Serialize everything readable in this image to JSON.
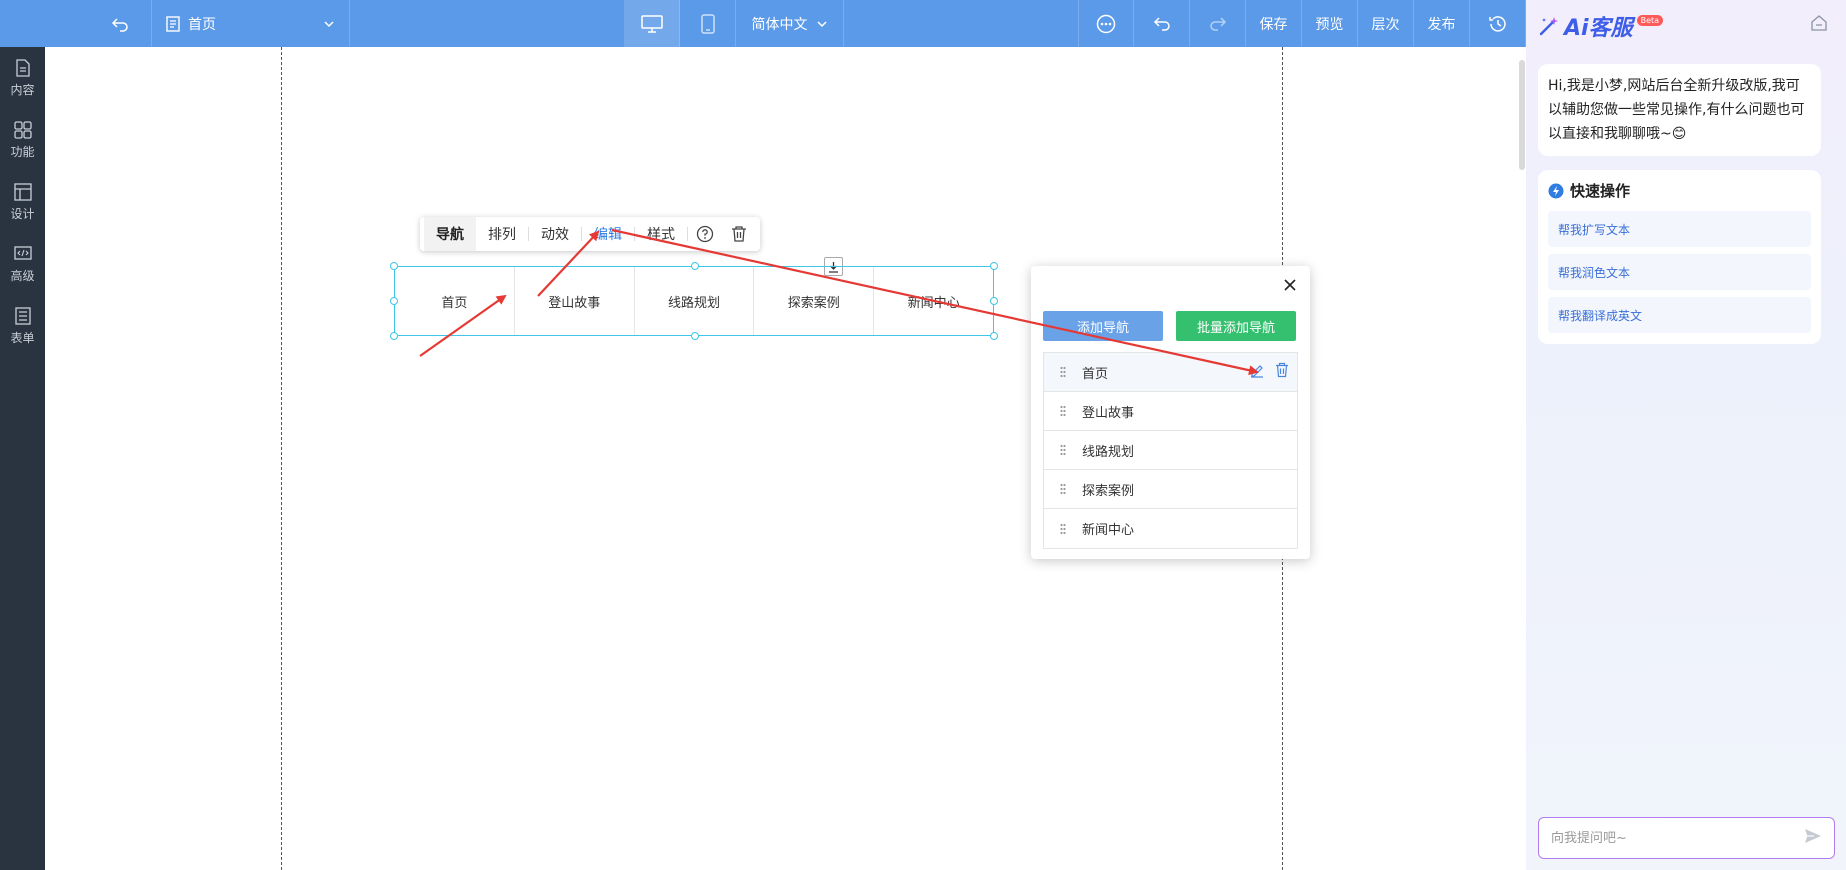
{
  "topbar": {
    "page_name": "首页",
    "language": "简体中文",
    "buttons": [
      "保存",
      "预览",
      "层次",
      "发布"
    ]
  },
  "sidebar": {
    "items": [
      {
        "label": "内容",
        "icon": "document-icon"
      },
      {
        "label": "功能",
        "icon": "grid-icon"
      },
      {
        "label": "设计",
        "icon": "layout-icon"
      },
      {
        "label": "高级",
        "icon": "code-icon"
      },
      {
        "label": "表单",
        "icon": "form-icon"
      }
    ]
  },
  "toolbar": {
    "tabs": [
      "导航",
      "排列",
      "动效",
      "编辑",
      "样式"
    ],
    "active": "编辑"
  },
  "nav": {
    "items": [
      "首页",
      "登山故事",
      "线路规划",
      "探索案例",
      "新闻中心"
    ]
  },
  "panel": {
    "add_label": "添加导航",
    "batch_label": "批量添加导航",
    "items": [
      "首页",
      "登山故事",
      "线路规划",
      "探索案例",
      "新闻中心"
    ]
  },
  "ai": {
    "title": "Ai客服",
    "beta": "Beta",
    "greeting": "Hi,我是小梦,网站后台全新升级改版,我可以辅助您做一些常见操作,有什么问题也可以直接和我聊聊哦~😊",
    "quick_title": "快速操作",
    "quick_items": [
      "帮我扩写文本",
      "帮我润色文本",
      "帮我翻译成英文"
    ],
    "input_placeholder": "向我提问吧~"
  },
  "colors": {
    "topbar": "#5b9ae8",
    "sidebar": "#2a3441",
    "accent": "#2f7de1",
    "add_button": "#6aa2e8",
    "batch_button": "#34c06e",
    "annotation_arrow": "#e53935"
  }
}
